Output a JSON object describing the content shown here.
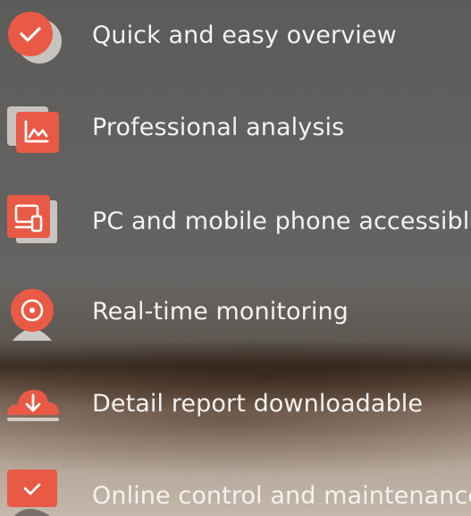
{
  "colors": {
    "accent": "#e85a45",
    "accent_light": "#f07a5e",
    "text": "#f4f2f0",
    "shadow_shape": "#d8d4d0"
  },
  "features": [
    {
      "icon": "check-circle-icon",
      "label": "Quick and easy overview"
    },
    {
      "icon": "chart-analysis-icon",
      "label": "Professional analysis"
    },
    {
      "icon": "pc-mobile-icon",
      "label": "PC and mobile phone accessible"
    },
    {
      "icon": "monitoring-camera-icon",
      "label": "Real-time monitoring"
    },
    {
      "icon": "cloud-download-icon",
      "label": "Detail report downloadable"
    },
    {
      "icon": "control-check-icon",
      "label": "Online control and maintenance"
    }
  ]
}
